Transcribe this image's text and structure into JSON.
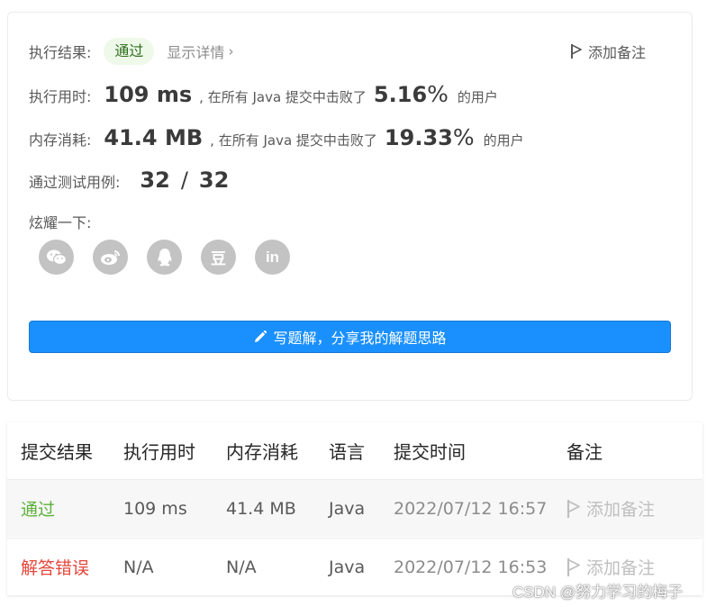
{
  "result": {
    "label": "执行结果:",
    "status": "通过",
    "details_link": "显示详情",
    "chevron": "›",
    "add_note": "添加备注"
  },
  "runtime": {
    "label": "执行用时:",
    "value": "109 ms",
    "beat_text": ", 在所有 Java 提交中击败了",
    "percent": "5.16",
    "percent_sign": "%",
    "users_text": "的用户"
  },
  "memory": {
    "label": "内存消耗:",
    "value": "41.4 MB",
    "beat_text": ", 在所有 Java 提交中击败了",
    "percent": "19.33",
    "percent_sign": "%",
    "users_text": "的用户"
  },
  "tests": {
    "label": "通过测试用例:",
    "passed": "32",
    "separator": "/",
    "total": "32"
  },
  "share": {
    "label": "炫耀一下:",
    "icons": [
      "wechat-icon",
      "weibo-icon",
      "qq-icon",
      "douban-icon",
      "linkedin-icon"
    ],
    "douban_glyph": "豆",
    "linkedin_glyph": "in"
  },
  "write_button": "写题解，分享我的解题思路",
  "table": {
    "headers": [
      "提交结果",
      "执行用时",
      "内存消耗",
      "语言",
      "提交时间",
      "备注"
    ],
    "rows": [
      {
        "result": "通过",
        "runtime": "109 ms",
        "memory": "41.4 MB",
        "language": "Java",
        "time": "2022/07/12 16:57",
        "note": "添加备注"
      },
      {
        "result": "解答错误",
        "runtime": "N/A",
        "memory": "N/A",
        "language": "Java",
        "time": "2022/07/12 16:53",
        "note": "添加备注"
      }
    ]
  },
  "watermark": "CSDN @努力学习的梅子",
  "colors": {
    "accent": "#1a90ff",
    "pass": "#5cb03a",
    "fail": "#e5463b",
    "icon_gray": "#c3c3c3"
  }
}
